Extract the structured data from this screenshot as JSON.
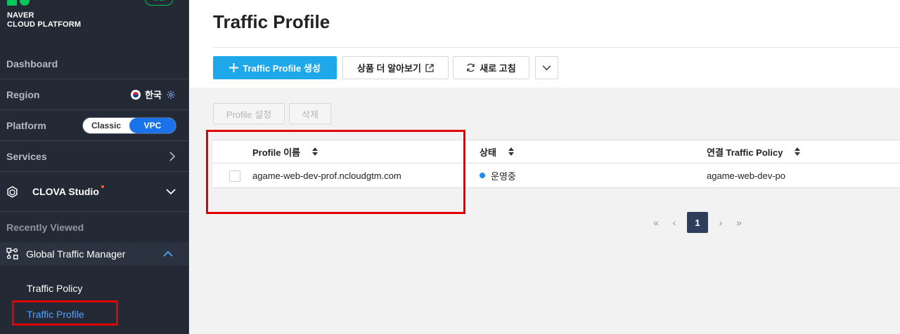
{
  "brand": {
    "line1": "NAVER",
    "line2": "CLOUD PLATFORM",
    "lang_badge": "한글"
  },
  "sidebar": {
    "dashboard": "Dashboard",
    "region_label": "Region",
    "region_value": "한국",
    "platform_label": "Platform",
    "platform_options": [
      "Classic",
      "VPC"
    ],
    "platform_selected": "VPC",
    "services": "Services",
    "clova": "CLOVA Studio",
    "recently_viewed": "Recently Viewed",
    "gtm": "Global Traffic Manager",
    "sub_items": [
      {
        "label": "Traffic Policy",
        "active": false
      },
      {
        "label": "Traffic Profile",
        "active": true
      }
    ]
  },
  "main": {
    "title": "Traffic Profile",
    "toolbar": {
      "create_label": "Traffic Profile 생성",
      "learn_more_label": "상품 더 알아보기",
      "refresh_label": "새로 고침"
    },
    "actions": {
      "profile_settings": "Profile 설정",
      "delete": "삭제"
    },
    "table": {
      "headers": [
        "Profile 이름",
        "상태",
        "연결 Traffic Policy"
      ],
      "rows": [
        {
          "name": "agame-web-dev-prof.ncloudgtm.com",
          "status": "운영중",
          "policy": "agame-web-dev-po"
        }
      ]
    },
    "pagination": {
      "current_page": "1"
    }
  },
  "colors": {
    "sidebar_bg": "#232a35",
    "primary_button": "#1ea7e9",
    "vpc_toggle": "#1a73e8",
    "highlight_box": "#e30000",
    "status_running": "#1e8bf0",
    "page_active": "#2f3e5c"
  }
}
